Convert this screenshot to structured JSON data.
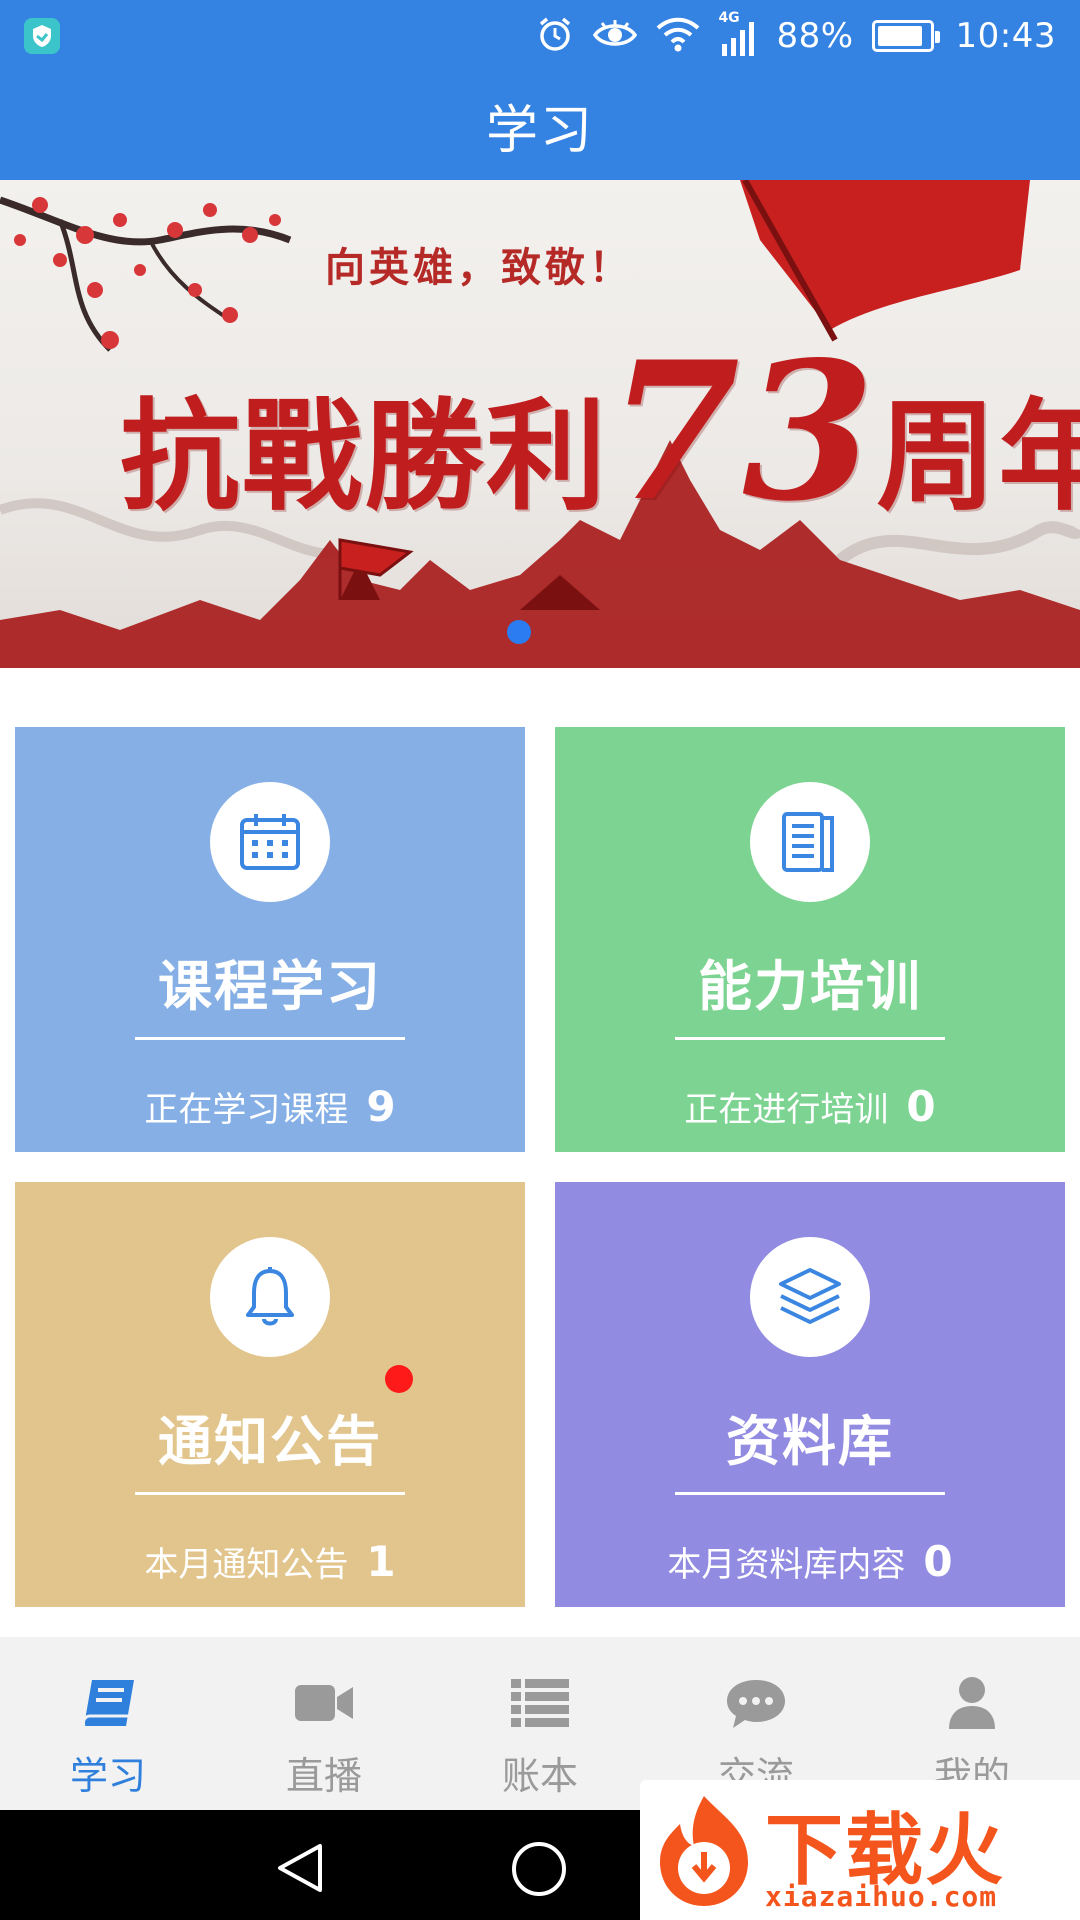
{
  "status_bar": {
    "network": "4G",
    "battery": "88%",
    "battery_level": 0.88,
    "time": "10:43",
    "icons": [
      "shield-app-icon",
      "alarm-icon",
      "eye-icon",
      "wifi-icon",
      "signal-icon",
      "battery-icon"
    ]
  },
  "header": {
    "title": "学习"
  },
  "banner": {
    "subtitle": "向英雄，致敬！",
    "headline_prefix": "抗戰勝利",
    "headline_number": "73",
    "headline_suffix": "周年",
    "accent": "#c01e1e"
  },
  "tiles": [
    {
      "title": "课程学习",
      "stat_label": "正在学习课程",
      "count": "9",
      "icon": "calendar-icon",
      "color": "#86b0e5"
    },
    {
      "title": "能力培训",
      "stat_label": "正在进行培训",
      "count": "0",
      "icon": "document-icon",
      "color": "#7dd492"
    },
    {
      "title": "通知公告",
      "stat_label": "本月通知公告",
      "count": "1",
      "icon": "bell-icon",
      "color": "#e2c58c",
      "unread": true
    },
    {
      "title": "资料库",
      "stat_label": "本月资料库内容",
      "count": "0",
      "icon": "layers-icon",
      "color": "#928be2"
    }
  ],
  "bottom_nav": {
    "items": [
      {
        "label": "学习",
        "icon": "book-icon",
        "active": true
      },
      {
        "label": "直播",
        "icon": "video-camera-icon"
      },
      {
        "label": "账本",
        "icon": "list-icon"
      },
      {
        "label": "交流",
        "icon": "chat-bubble-icon"
      },
      {
        "label": "我的",
        "icon": "person-icon"
      }
    ],
    "active_color": "#2f7fdc",
    "inactive_color": "#9a9a9a"
  },
  "watermark": {
    "title": "下载火",
    "url": "xiazaihuo.com"
  },
  "system_nav": {
    "icons": [
      "back-icon",
      "home-icon"
    ]
  }
}
